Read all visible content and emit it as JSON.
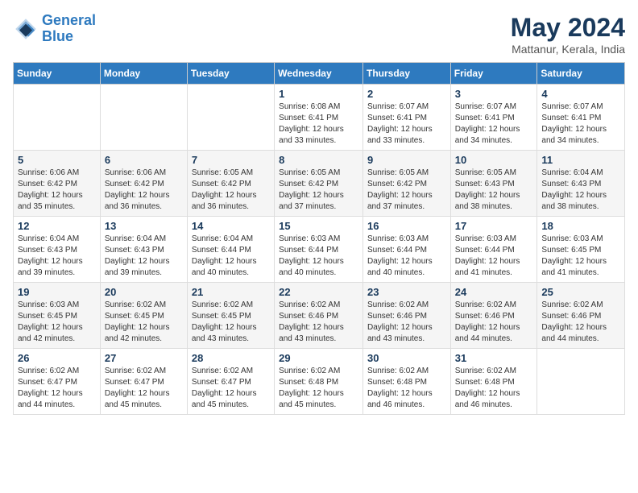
{
  "header": {
    "logo_line1": "General",
    "logo_line2": "Blue",
    "month": "May 2024",
    "location": "Mattanur, Kerala, India"
  },
  "weekdays": [
    "Sunday",
    "Monday",
    "Tuesday",
    "Wednesday",
    "Thursday",
    "Friday",
    "Saturday"
  ],
  "weeks": [
    [
      {
        "day": "",
        "info": ""
      },
      {
        "day": "",
        "info": ""
      },
      {
        "day": "",
        "info": ""
      },
      {
        "day": "1",
        "info": "Sunrise: 6:08 AM\nSunset: 6:41 PM\nDaylight: 12 hours\nand 33 minutes."
      },
      {
        "day": "2",
        "info": "Sunrise: 6:07 AM\nSunset: 6:41 PM\nDaylight: 12 hours\nand 33 minutes."
      },
      {
        "day": "3",
        "info": "Sunrise: 6:07 AM\nSunset: 6:41 PM\nDaylight: 12 hours\nand 34 minutes."
      },
      {
        "day": "4",
        "info": "Sunrise: 6:07 AM\nSunset: 6:41 PM\nDaylight: 12 hours\nand 34 minutes."
      }
    ],
    [
      {
        "day": "5",
        "info": "Sunrise: 6:06 AM\nSunset: 6:42 PM\nDaylight: 12 hours\nand 35 minutes."
      },
      {
        "day": "6",
        "info": "Sunrise: 6:06 AM\nSunset: 6:42 PM\nDaylight: 12 hours\nand 36 minutes."
      },
      {
        "day": "7",
        "info": "Sunrise: 6:05 AM\nSunset: 6:42 PM\nDaylight: 12 hours\nand 36 minutes."
      },
      {
        "day": "8",
        "info": "Sunrise: 6:05 AM\nSunset: 6:42 PM\nDaylight: 12 hours\nand 37 minutes."
      },
      {
        "day": "9",
        "info": "Sunrise: 6:05 AM\nSunset: 6:42 PM\nDaylight: 12 hours\nand 37 minutes."
      },
      {
        "day": "10",
        "info": "Sunrise: 6:05 AM\nSunset: 6:43 PM\nDaylight: 12 hours\nand 38 minutes."
      },
      {
        "day": "11",
        "info": "Sunrise: 6:04 AM\nSunset: 6:43 PM\nDaylight: 12 hours\nand 38 minutes."
      }
    ],
    [
      {
        "day": "12",
        "info": "Sunrise: 6:04 AM\nSunset: 6:43 PM\nDaylight: 12 hours\nand 39 minutes."
      },
      {
        "day": "13",
        "info": "Sunrise: 6:04 AM\nSunset: 6:43 PM\nDaylight: 12 hours\nand 39 minutes."
      },
      {
        "day": "14",
        "info": "Sunrise: 6:04 AM\nSunset: 6:44 PM\nDaylight: 12 hours\nand 40 minutes."
      },
      {
        "day": "15",
        "info": "Sunrise: 6:03 AM\nSunset: 6:44 PM\nDaylight: 12 hours\nand 40 minutes."
      },
      {
        "day": "16",
        "info": "Sunrise: 6:03 AM\nSunset: 6:44 PM\nDaylight: 12 hours\nand 40 minutes."
      },
      {
        "day": "17",
        "info": "Sunrise: 6:03 AM\nSunset: 6:44 PM\nDaylight: 12 hours\nand 41 minutes."
      },
      {
        "day": "18",
        "info": "Sunrise: 6:03 AM\nSunset: 6:45 PM\nDaylight: 12 hours\nand 41 minutes."
      }
    ],
    [
      {
        "day": "19",
        "info": "Sunrise: 6:03 AM\nSunset: 6:45 PM\nDaylight: 12 hours\nand 42 minutes."
      },
      {
        "day": "20",
        "info": "Sunrise: 6:02 AM\nSunset: 6:45 PM\nDaylight: 12 hours\nand 42 minutes."
      },
      {
        "day": "21",
        "info": "Sunrise: 6:02 AM\nSunset: 6:45 PM\nDaylight: 12 hours\nand 43 minutes."
      },
      {
        "day": "22",
        "info": "Sunrise: 6:02 AM\nSunset: 6:46 PM\nDaylight: 12 hours\nand 43 minutes."
      },
      {
        "day": "23",
        "info": "Sunrise: 6:02 AM\nSunset: 6:46 PM\nDaylight: 12 hours\nand 43 minutes."
      },
      {
        "day": "24",
        "info": "Sunrise: 6:02 AM\nSunset: 6:46 PM\nDaylight: 12 hours\nand 44 minutes."
      },
      {
        "day": "25",
        "info": "Sunrise: 6:02 AM\nSunset: 6:46 PM\nDaylight: 12 hours\nand 44 minutes."
      }
    ],
    [
      {
        "day": "26",
        "info": "Sunrise: 6:02 AM\nSunset: 6:47 PM\nDaylight: 12 hours\nand 44 minutes."
      },
      {
        "day": "27",
        "info": "Sunrise: 6:02 AM\nSunset: 6:47 PM\nDaylight: 12 hours\nand 45 minutes."
      },
      {
        "day": "28",
        "info": "Sunrise: 6:02 AM\nSunset: 6:47 PM\nDaylight: 12 hours\nand 45 minutes."
      },
      {
        "day": "29",
        "info": "Sunrise: 6:02 AM\nSunset: 6:48 PM\nDaylight: 12 hours\nand 45 minutes."
      },
      {
        "day": "30",
        "info": "Sunrise: 6:02 AM\nSunset: 6:48 PM\nDaylight: 12 hours\nand 46 minutes."
      },
      {
        "day": "31",
        "info": "Sunrise: 6:02 AM\nSunset: 6:48 PM\nDaylight: 12 hours\nand 46 minutes."
      },
      {
        "day": "",
        "info": ""
      }
    ]
  ]
}
